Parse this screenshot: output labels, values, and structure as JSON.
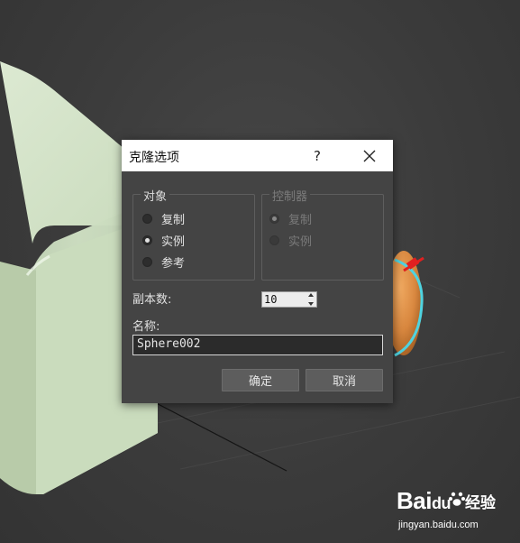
{
  "dialog": {
    "title": "克隆选项",
    "help_label": "?",
    "object_group": {
      "title": "对象",
      "options": [
        {
          "label": "复制",
          "selected": false
        },
        {
          "label": "实例",
          "selected": true
        },
        {
          "label": "参考",
          "selected": false
        }
      ]
    },
    "controller_group": {
      "title": "控制器",
      "enabled": false,
      "options": [
        {
          "label": "复制",
          "selected": true
        },
        {
          "label": "实例",
          "selected": false
        }
      ]
    },
    "copies_label": "副本数:",
    "copies_value": "10",
    "name_label": "名称:",
    "name_value": "Sphere002",
    "ok_label": "确定",
    "cancel_label": "取消"
  },
  "watermark": {
    "brand": "Bai",
    "brand_tail": "du",
    "cn": "经验",
    "url": "jingyan.baidu.com"
  },
  "colors": {
    "dialog_bg": "#444444",
    "box_color": "#cfe0c3",
    "sphere_color": "#d8873f",
    "selection_cyan": "#4fd3e0",
    "gizmo_red": "#e02020"
  }
}
